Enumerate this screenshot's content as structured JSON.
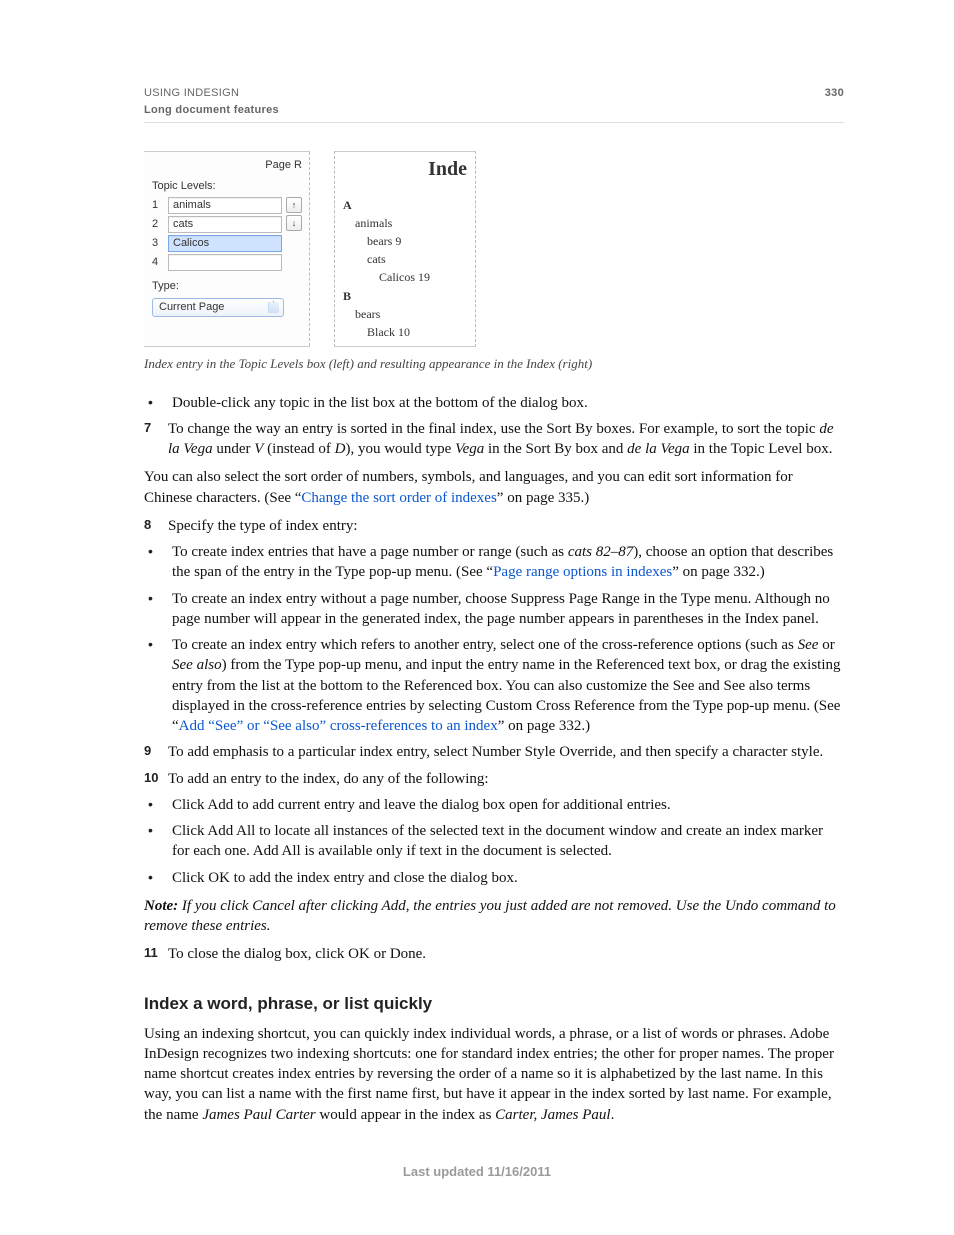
{
  "header": {
    "line1": "USING INDESIGN",
    "line2": "Long document features",
    "page_number": "330"
  },
  "figure": {
    "pageR": "Page R",
    "topic_levels_label": "Topic Levels:",
    "levels": [
      {
        "n": "1",
        "value": "animals"
      },
      {
        "n": "2",
        "value": "cats"
      },
      {
        "n": "3",
        "value": "Calicos"
      },
      {
        "n": "4",
        "value": ""
      }
    ],
    "btn_up": "↑",
    "btn_down": "↓",
    "type_label": "Type:",
    "type_value": "Current Page",
    "result": {
      "title": "Inde",
      "secA": "A",
      "a1": "animals",
      "a2": "bears  9",
      "a3": "cats",
      "a4": "Calicos  19",
      "secB": "B",
      "b1": "bears",
      "b2": "Black  10"
    }
  },
  "caption": "Index entry in the Topic Levels box (left) and resulting appearance in the Index (right)",
  "body": {
    "bullet1": "Double-click any topic in the list box at the bottom of the dialog box.",
    "step7_a": "To change the way an entry is sorted in the final index, use the Sort By boxes. For example, to sort the topic ",
    "step7_i1": "de la Vega",
    "step7_b": " under ",
    "step7_i2": "V",
    "step7_c": " (instead of ",
    "step7_i3": "D",
    "step7_d": "), you would type ",
    "step7_i4": "Vega",
    "step7_e": " in the Sort By box and ",
    "step7_i5": "de la Vega",
    "step7_f": " in the Topic Level box.",
    "para_sort_a": "You can also select the sort order of numbers, symbols, and languages, and you can edit sort information for Chinese characters. (See “",
    "link_sort": "Change the sort order of indexes",
    "para_sort_b": "” on page 335.)",
    "step8": "Specify the type of index entry:",
    "bullet8a_a": "To create index entries that have a page number or range (such as ",
    "bullet8a_i": "cats 82–87",
    "bullet8a_b": "), choose an option that describes the span of the entry in the Type pop-up menu. (See “",
    "link_pagerange": "Page range options in indexes",
    "bullet8a_c": "” on page 332.)",
    "bullet8b": "To create an index entry without a page number, choose Suppress Page Range in the Type menu. Although no page number will appear in the generated index, the page number appears in parentheses in the Index panel.",
    "bullet8c_a": "To create an index entry which refers to another entry, select one of the cross-reference options (such as ",
    "bullet8c_i1": "See",
    "bullet8c_b": " or ",
    "bullet8c_i2": "See also",
    "bullet8c_c": ") from the Type pop-up menu, and input the entry name in the Referenced text box, or drag the existing entry from the list at the bottom to the Referenced box. You can also customize the See and See also terms displayed in the cross-reference entries by selecting Custom Cross Reference from the Type pop-up menu. (See “",
    "link_addsee": "Add “See” or “See also” cross-references to an index",
    "bullet8c_d": "” on page 332.)",
    "step9": "To add emphasis to a particular index entry, select Number Style Override, and then specify a character style.",
    "step10": "To add an entry to the index, do any of the following:",
    "bullet10a": "Click Add to add current entry and leave the dialog box open for additional entries.",
    "bullet10b": "Click Add All to locate all instances of the selected text in the document window and create an index marker for each one. Add All is available only if text in the document is selected.",
    "bullet10c": "Click OK to add the index entry and close the dialog box.",
    "note_prefix": "Note:",
    "note_body": " If you click Cancel after clicking Add, the entries you just added are not removed. Use the Undo command to remove these entries.",
    "step11": "To close the dialog box, click OK or Done.",
    "heading2": "Index a word, phrase, or list quickly",
    "para2_a": "Using an indexing shortcut, you can quickly index individual words, a phrase, or a list of words or phrases. Adobe InDesign recognizes two indexing shortcuts: one for standard index entries; the other for proper names. The proper name shortcut creates index entries by reversing the order of a name so it is alphabetized by the last name. In this way, you can list a name with the first name first, but have it appear in the index sorted by last name. For example, the name ",
    "para2_i1": "James Paul Carter",
    "para2_b": " would appear in the index as ",
    "para2_i2": "Carter, James Paul",
    "para2_c": "."
  },
  "footer": "Last updated 11/16/2011"
}
